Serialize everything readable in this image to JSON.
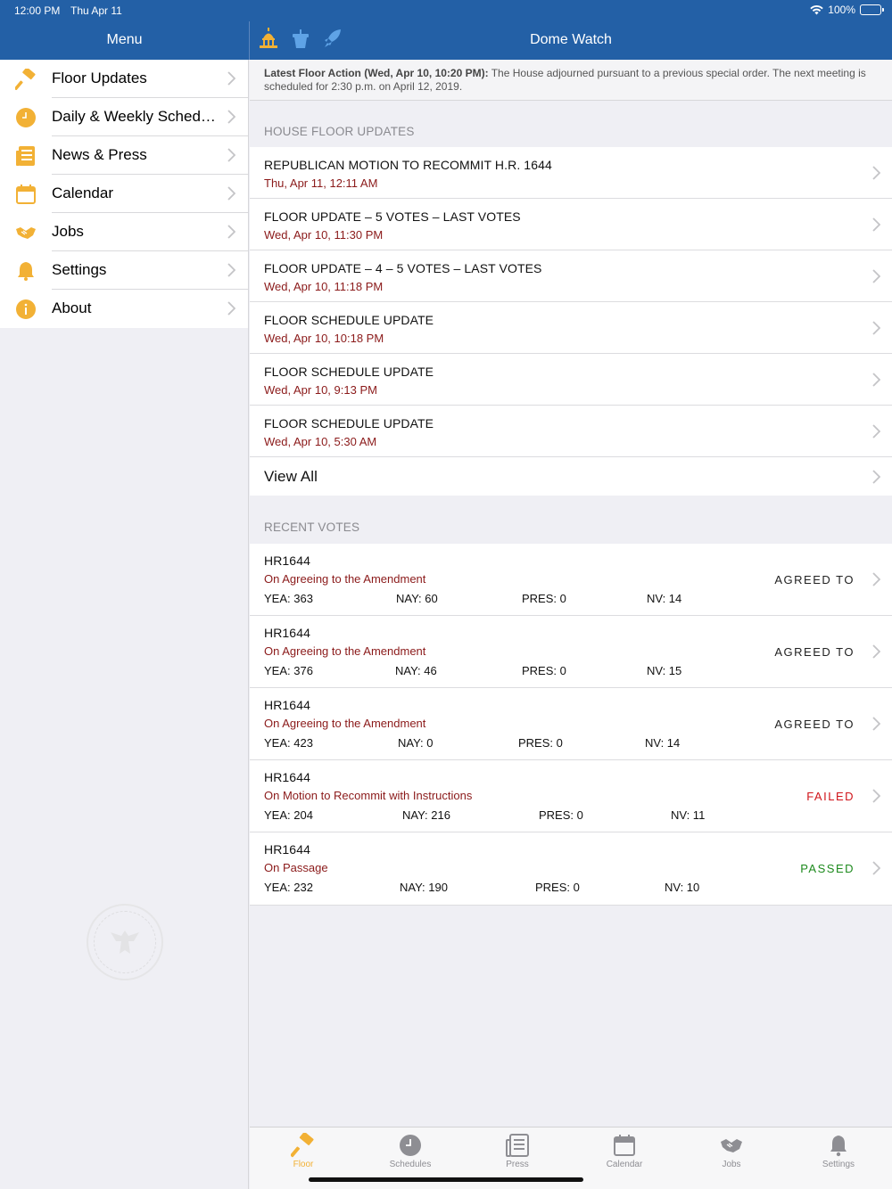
{
  "status_bar": {
    "time": "12:00 PM",
    "date": "Thu Apr 11",
    "battery": "100%"
  },
  "sidebar": {
    "title": "Menu",
    "items": [
      {
        "label": "Floor Updates",
        "icon": "gavel-icon"
      },
      {
        "label": "Daily & Weekly Schedu...",
        "icon": "clock-icon"
      },
      {
        "label": "News & Press",
        "icon": "news-icon"
      },
      {
        "label": "Calendar",
        "icon": "calendar-icon"
      },
      {
        "label": "Jobs",
        "icon": "handshake-icon"
      },
      {
        "label": "Settings",
        "icon": "bell-icon"
      },
      {
        "label": "About",
        "icon": "info-icon"
      }
    ]
  },
  "header": {
    "title": "Dome Watch",
    "icons": [
      "capitol-icon",
      "podium-icon",
      "rocket-icon"
    ]
  },
  "latest": {
    "label": "Latest Floor Action (Wed, Apr 10, 10:20 PM):",
    "text": " The House adjourned pursuant to a previous special order. The next meeting is scheduled for 2:30 p.m. on April 12, 2019."
  },
  "floor_updates": {
    "heading": "HOUSE FLOOR UPDATES",
    "items": [
      {
        "title": "REPUBLICAN MOTION TO RECOMMIT H.R. 1644",
        "time": "Thu, Apr 11, 12:11 AM"
      },
      {
        "title": "FLOOR UPDATE – 5 VOTES – LAST VOTES",
        "time": "Wed, Apr 10, 11:30 PM"
      },
      {
        "title": "FLOOR UPDATE – 4 – 5 VOTES – LAST VOTES",
        "time": "Wed, Apr 10, 11:18 PM"
      },
      {
        "title": "FLOOR SCHEDULE UPDATE",
        "time": "Wed, Apr 10, 10:18 PM"
      },
      {
        "title": "FLOOR SCHEDULE UPDATE",
        "time": "Wed, Apr 10, 9:13 PM"
      },
      {
        "title": "FLOOR SCHEDULE UPDATE",
        "time": "Wed, Apr 10, 5:30 AM"
      }
    ],
    "view_all": "View All"
  },
  "recent_votes": {
    "heading": "RECENT VOTES",
    "items": [
      {
        "bill": "HR1644",
        "question": "On Agreeing to the Amendment",
        "result": "AGREED TO",
        "yea": "YEA: 363",
        "nay": "NAY: 60",
        "pres": "PRES: 0",
        "nv": "NV: 14"
      },
      {
        "bill": "HR1644",
        "question": "On Agreeing to the Amendment",
        "result": "AGREED TO",
        "yea": "YEA: 376",
        "nay": "NAY: 46",
        "pres": "PRES: 0",
        "nv": "NV: 15"
      },
      {
        "bill": "HR1644",
        "question": "On Agreeing to the Amendment",
        "result": "AGREED TO",
        "yea": "YEA: 423",
        "nay": "NAY: 0",
        "pres": "PRES: 0",
        "nv": "NV: 14"
      },
      {
        "bill": "HR1644",
        "question": "On Motion to Recommit with Instructions",
        "result": "FAILED",
        "yea": "YEA: 204",
        "nay": "NAY: 216",
        "pres": "PRES: 0",
        "nv": "NV: 11"
      },
      {
        "bill": "HR1644",
        "question": "On Passage",
        "result": "PASSED",
        "yea": "YEA: 232",
        "nay": "NAY: 190",
        "pres": "PRES: 0",
        "nv": "NV: 10"
      }
    ]
  },
  "tabs": [
    {
      "label": "Floor",
      "icon": "gavel-icon",
      "active": true
    },
    {
      "label": "Schedules",
      "icon": "clock-icon",
      "active": false
    },
    {
      "label": "Press",
      "icon": "news-icon",
      "active": false
    },
    {
      "label": "Calendar",
      "icon": "calendar-icon",
      "active": false
    },
    {
      "label": "Jobs",
      "icon": "handshake-icon",
      "active": false
    },
    {
      "label": "Settings",
      "icon": "bell-icon",
      "active": false
    }
  ],
  "colors": {
    "brand_blue": "#2360a6",
    "accent_gold": "#f2b135",
    "time_red": "#8b1a1a",
    "failed_red": "#d0141a",
    "passed_green": "#1d8a1d"
  }
}
